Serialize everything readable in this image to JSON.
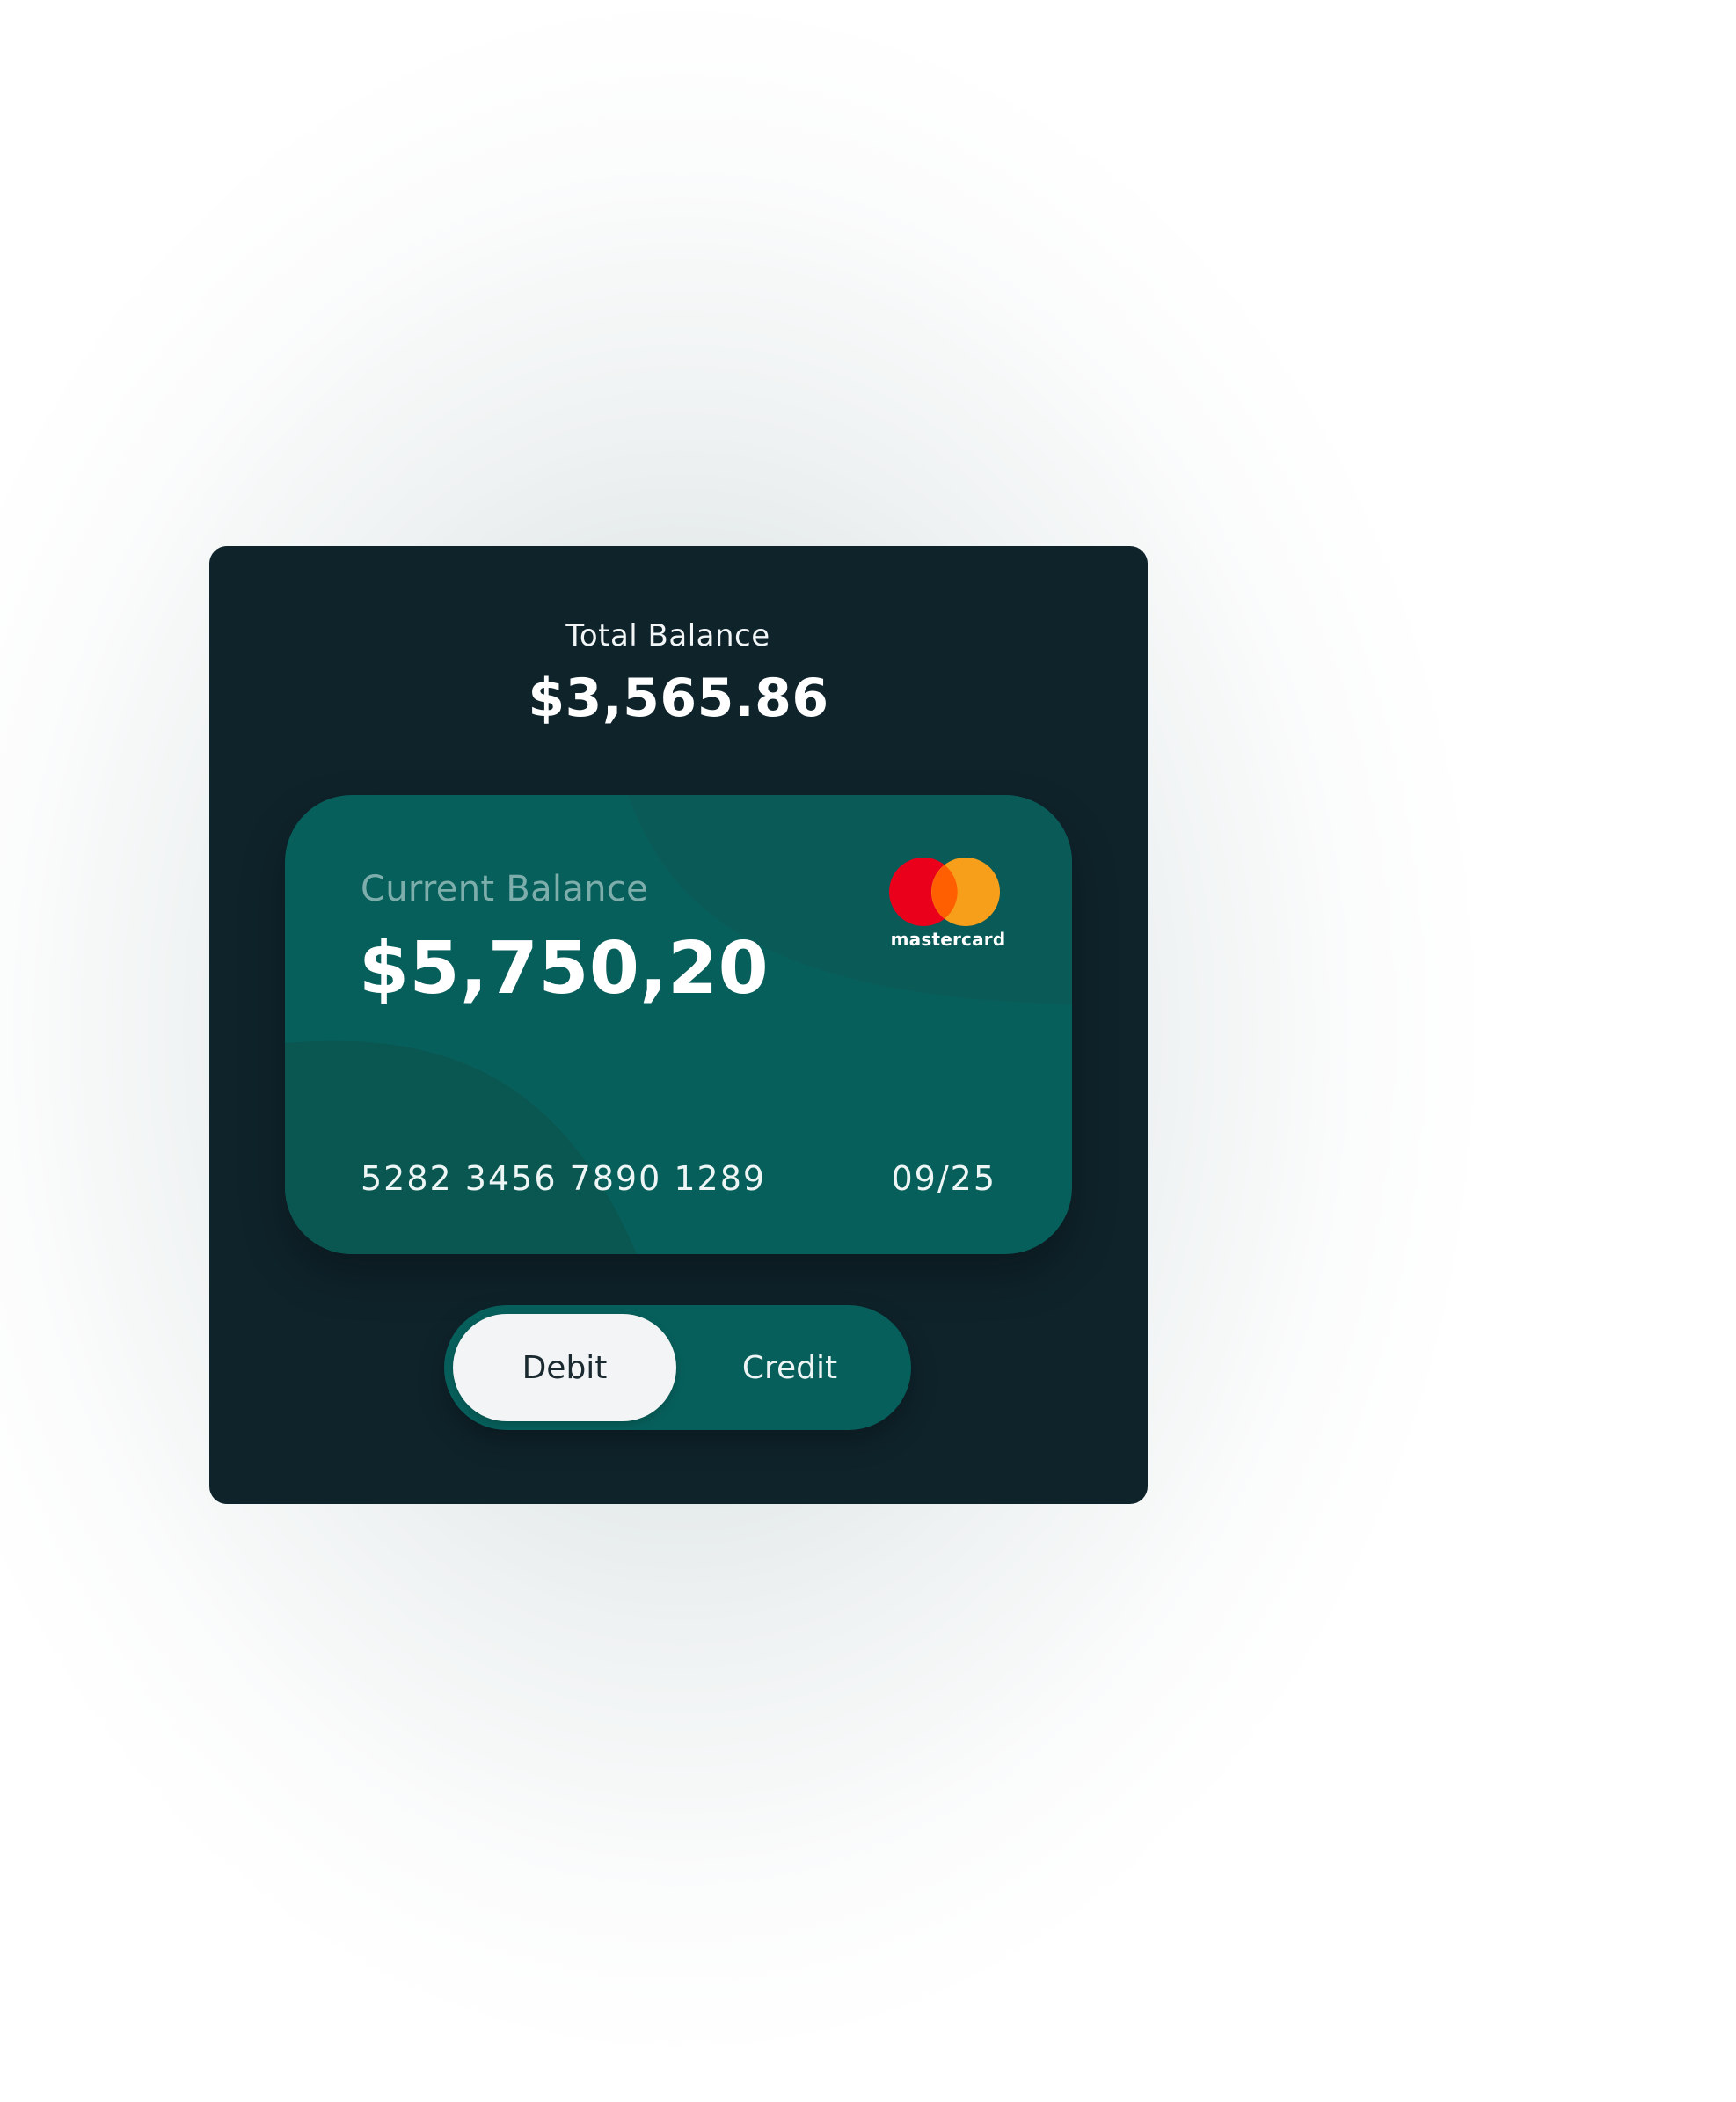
{
  "summary": {
    "total_label": "Total Balance",
    "total_amount": "$3,565.86"
  },
  "card": {
    "label": "Current Balance",
    "amount": "$5,750,20",
    "number": "5282 3456 7890 1289",
    "expiry": "09/25",
    "brand": "mastercard",
    "brand_icon": "mastercard-logo-icon"
  },
  "toggle": {
    "options": [
      "Debit",
      "Credit"
    ],
    "selected": "Debit"
  },
  "colors": {
    "panel": "#0f232b",
    "card": "#075f5b",
    "toggle_active": "#f3f4f5",
    "mastercard_red": "#eb001b",
    "mastercard_orange": "#f79e1b",
    "mastercard_overlap": "#ff5f00"
  }
}
